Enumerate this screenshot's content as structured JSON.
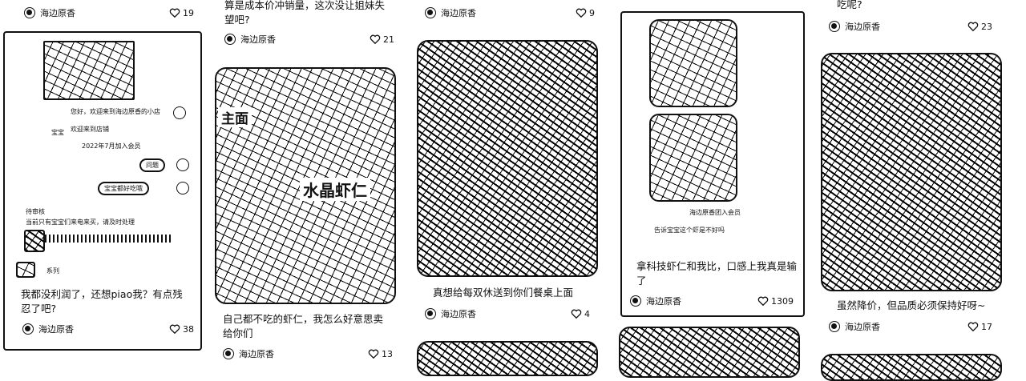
{
  "author": "海边原香",
  "col1": {
    "top_likes": "19",
    "card": {
      "chat_greeting": "您好，欢迎来到海边原香的小店",
      "chat_small_1": "宝宝",
      "chat_small_2": "欢迎来到店铺",
      "chat_join": "2022年7月加入会员",
      "pill_1": "问题",
      "pill_2": "宝宝都好吃哦",
      "chat_user_1": "待审核",
      "chat_user_2": "当前只有宝宝们来电来买，请及时处理",
      "chat_user_3": "系列",
      "title": "我都没利润了，还想piao我？有点残忍了吧?",
      "likes": "38"
    }
  },
  "col2": {
    "top_title": "算是成本价冲销量，这次没让姐妹失望吧?",
    "top_likes": "21",
    "card": {
      "overlay": "水晶虾仁",
      "overlay_left": "主面",
      "title": "自己都不吃的虾仁，我怎么好意思卖给你们",
      "likes": "13"
    }
  },
  "col3": {
    "top_likes": "9",
    "card": {
      "title": "真想给每双休送到你们餐桌上面",
      "likes": "4"
    }
  },
  "col4": {
    "card": {
      "caption_1": "海边原香团入会员",
      "caption_2": "告诉宝宝这个虾是不好吗",
      "title": "拿科技虾仁和我比，口感上我真是输了",
      "likes": "1309"
    }
  },
  "col5": {
    "top_title": "吃呢?",
    "top_likes": "23",
    "card": {
      "title": "虽然降价，但品质必须保持好呀~",
      "likes": "17"
    }
  }
}
